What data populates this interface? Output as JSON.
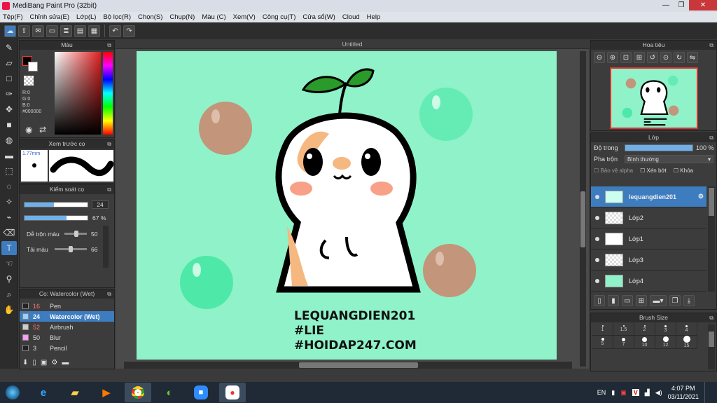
{
  "window": {
    "title": "MediBang Paint Pro (32bit)",
    "minimize": "—",
    "maximize": "❐",
    "close": "✕"
  },
  "menu": [
    "Tệp(F)",
    "Chỉnh sửa(E)",
    "Lớp(L)",
    "Bộ lọc(R)",
    "Chọn(S)",
    "Chụp(N)",
    "Màu (C)",
    "Xem(V)",
    "Công cụ(T)",
    "Cửa sổ(W)",
    "Cloud",
    "Help"
  ],
  "toolbar": {
    "undo": "↶",
    "redo": "↷",
    "icons": [
      "cloud-icon",
      "export-icon",
      "comment-icon",
      "page-icon",
      "document-icon",
      "manage-icon",
      "grid-icon"
    ]
  },
  "color_panel": {
    "title": "Màu",
    "r": "R:0",
    "g": "G:0",
    "b": "B:0",
    "hex": "#000000",
    "accent": "#000000"
  },
  "brush_preview": {
    "title": "Xem trước cọ",
    "size": "1.77mm"
  },
  "brush_control": {
    "title": "Kiểm soát cọ",
    "size_value": "24",
    "opacity_value": "67",
    "opacity_unit": "%",
    "opacity_level": 0.67,
    "mix_label": "Dễ trộn màu",
    "mix_value": "50",
    "flow_label": "Tải màu",
    "flow_value": "66"
  },
  "brush_list": {
    "title": "Cọ: Watercolor (Wet)",
    "items": [
      {
        "num": "16",
        "name": "Pen",
        "color": "#222222"
      },
      {
        "num": "24",
        "name": "Watercolor (Wet)",
        "color": "#9ad0ff"
      },
      {
        "num": "52",
        "name": "Airbrush",
        "color": "#cccccc"
      },
      {
        "num": "50",
        "name": "Blur",
        "color": "#ff99ff"
      },
      {
        "num": "3",
        "name": "Pencil",
        "color": "#222222"
      }
    ]
  },
  "canvas": {
    "title": "Untitled",
    "bg_color": "#8ff2c9",
    "text_line1": "LEQUANGDIEN201",
    "text_line2": "#LIE",
    "text_line3": "#HOIDAP247.COM"
  },
  "navigator": {
    "title": "Hoa tiêu"
  },
  "layers": {
    "title": "Lớp",
    "opacity_label": "Độ trong",
    "opacity_value": "100 %",
    "opacity_level": 1.0,
    "blend_label": "Pha trộn",
    "blend_value": "Bình thường",
    "protect_alpha": "Bảo vệ alpha",
    "clip": "Xén bớt",
    "lock": "Khóa",
    "items": [
      {
        "name": "lequangdien201",
        "selected": true
      },
      {
        "name": "Lớp2",
        "selected": false
      },
      {
        "name": "Lớp1",
        "selected": false
      },
      {
        "name": "Lớp3",
        "selected": false
      },
      {
        "name": "Lớp4",
        "selected": false
      }
    ]
  },
  "brush_size": {
    "title": "Brush Size",
    "sizes": [
      "1",
      "1.5",
      "2",
      "3",
      "4",
      "5",
      "7",
      "10",
      "12",
      "15"
    ]
  },
  "taskbar": {
    "lang": "EN",
    "time": "4:07 PM",
    "date": "03/11/2021"
  }
}
